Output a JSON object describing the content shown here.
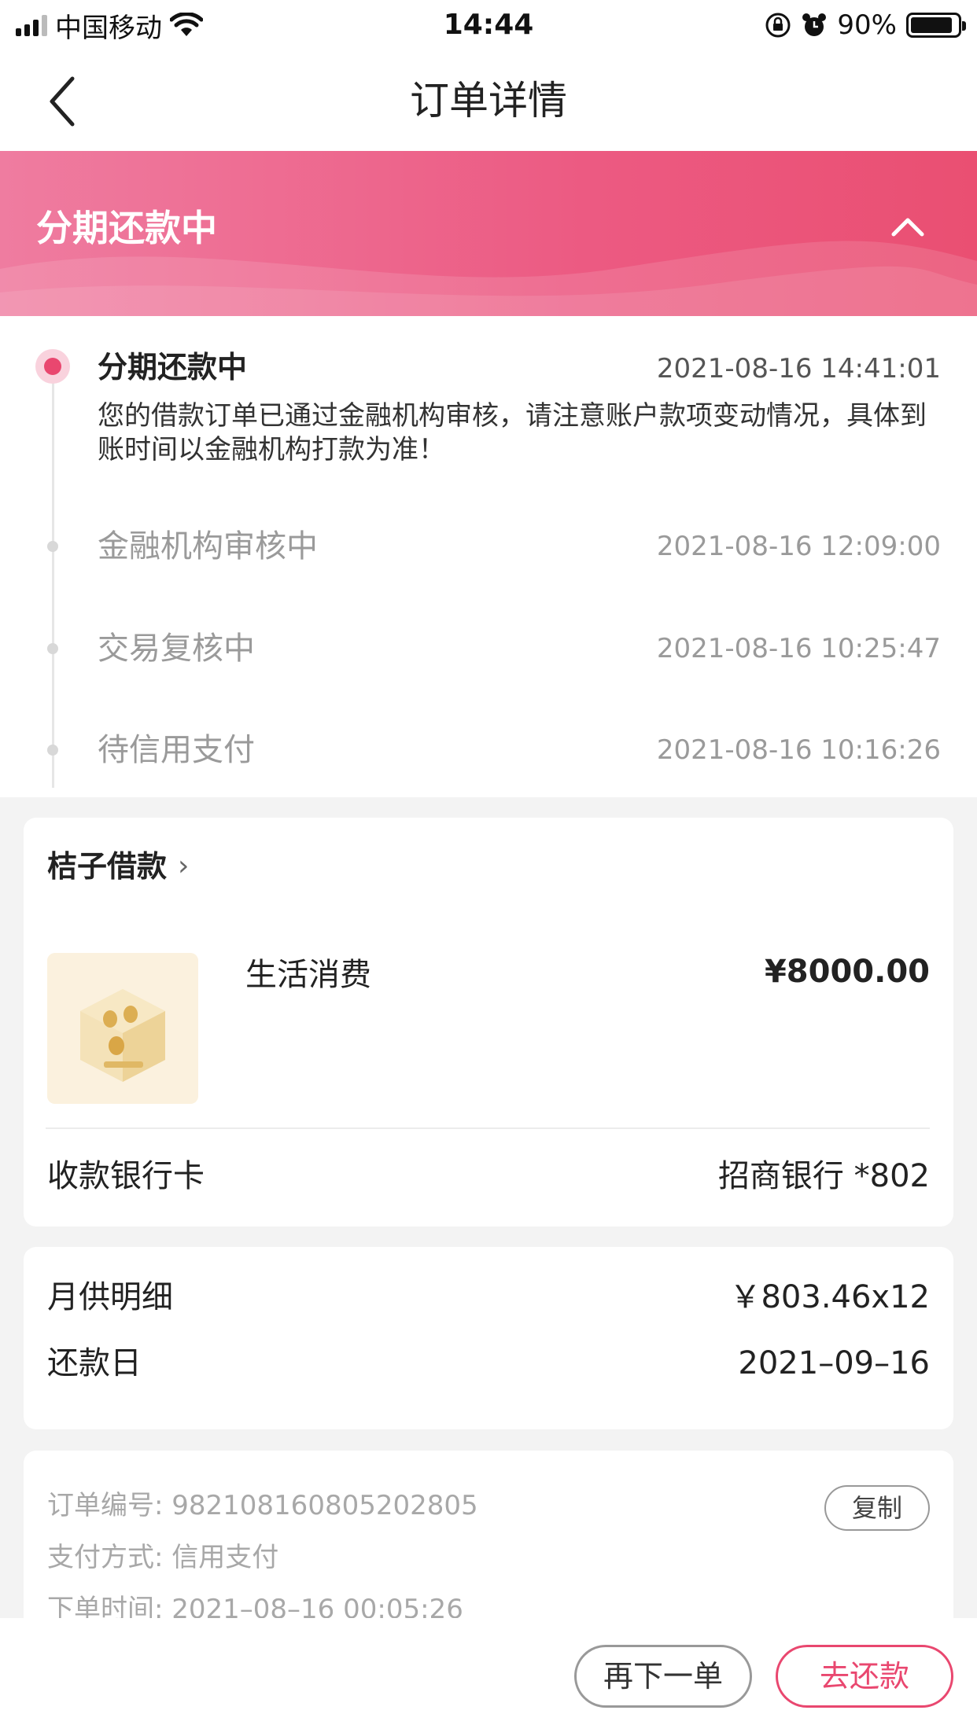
{
  "status_bar": {
    "carrier": "中国移动",
    "time": "14:44",
    "battery_percent": "90%",
    "battery_level": 0.9
  },
  "nav": {
    "title": "订单详情",
    "back_icon": "chevron-left-icon"
  },
  "banner": {
    "title": "分期还款中",
    "collapse_icon": "chevron-up-icon",
    "color_start": "#ef7ca0",
    "color_end": "#ea4f72"
  },
  "timeline": {
    "current": {
      "title": "分期还款中",
      "time": "2021-08-16 14:41:01",
      "description": "您的借款订单已通过金融机构审核，请注意账户款项变动情况，具体到账时间以金融机构打款为准！"
    },
    "history": [
      {
        "title": "金融机构审核中",
        "time": "2021-08-16 12:09:00"
      },
      {
        "title": "交易复核中",
        "time": "2021-08-16 10:25:47"
      },
      {
        "title": "待信用支付",
        "time": "2021-08-16 10:16:26"
      }
    ],
    "accent": "#e9476f"
  },
  "order_card": {
    "merchant": "桔子借款",
    "merchant_chevron": "›",
    "product_name": "生活消费",
    "product_price": "¥8000.00",
    "bank_label": "收款银行卡",
    "bank_value": "招商银行 *802"
  },
  "repay_card": {
    "monthly_label": "月供明细",
    "monthly_value": "￥803.46x12",
    "due_label": "还款日",
    "due_value": "2021–09–16"
  },
  "info_card": {
    "order_no": "订单编号: 982108160805202805",
    "payment": "支付方式: 信用支付",
    "order_time": "下单时间: 2021–08–16 00:05:26",
    "copy_label": "复制"
  },
  "actions": {
    "reorder_label": "再下一单",
    "repay_label": "去还款"
  }
}
